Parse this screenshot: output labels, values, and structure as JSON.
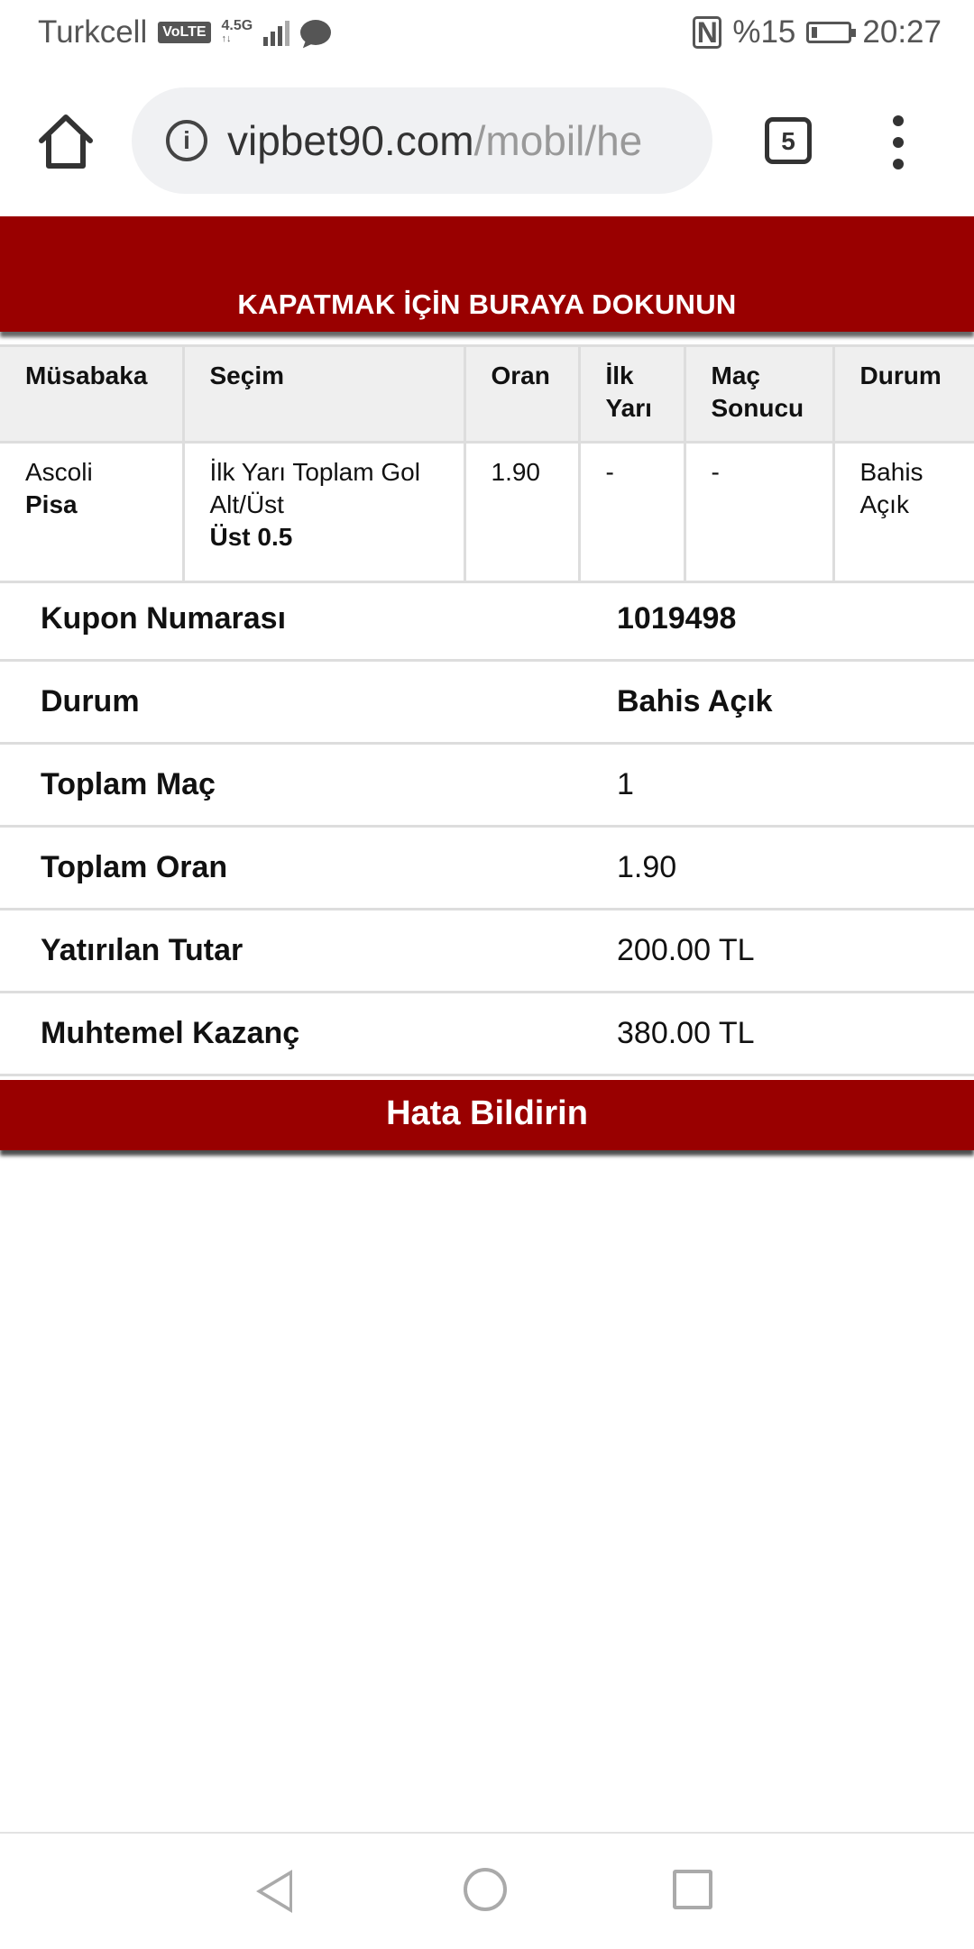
{
  "status_bar": {
    "carrier": "Turkcell",
    "volte": "VoLTE",
    "network": "4.5G",
    "battery_percent": "%15",
    "time": "20:27",
    "icons": [
      "signal-icon",
      "message-icon",
      "nfc-icon",
      "battery-charging-icon"
    ]
  },
  "browser": {
    "url_domain": "vipbet90.com",
    "url_path": "/mobil/he",
    "tab_count": "5"
  },
  "banner": {
    "close_text": "KAPATMAK İÇİN BURAYA DOKUNUN"
  },
  "match_table": {
    "headers": [
      "Müsabaka",
      "Seçim",
      "Oran",
      "İlk Yarı",
      "Maç Sonucu",
      "Durum"
    ],
    "rows": [
      {
        "home": "Ascoli",
        "away": "Pisa",
        "selection_market": "İlk Yarı Toplam Gol Alt/Üst",
        "selection_pick": "Üst 0.5",
        "odds": "1.90",
        "first_half": "-",
        "full_time": "-",
        "status": "Bahis Açık"
      }
    ]
  },
  "summary": [
    {
      "label": "Kupon Numarası",
      "value": "1019498"
    },
    {
      "label": "Durum",
      "value": "Bahis Açık"
    },
    {
      "label": "Toplam Maç",
      "value": "1"
    },
    {
      "label": "Toplam Oran",
      "value": "1.90"
    },
    {
      "label": "Yatırılan Tutar",
      "value": "200.00 TL"
    },
    {
      "label": "Muhtemel Kazanç",
      "value": "380.00 TL"
    }
  ],
  "report_button": "Hata Bildirin",
  "colors": {
    "brand_red": "#990000",
    "header_bg": "#efefef",
    "url_bg": "#f0f1f3"
  }
}
